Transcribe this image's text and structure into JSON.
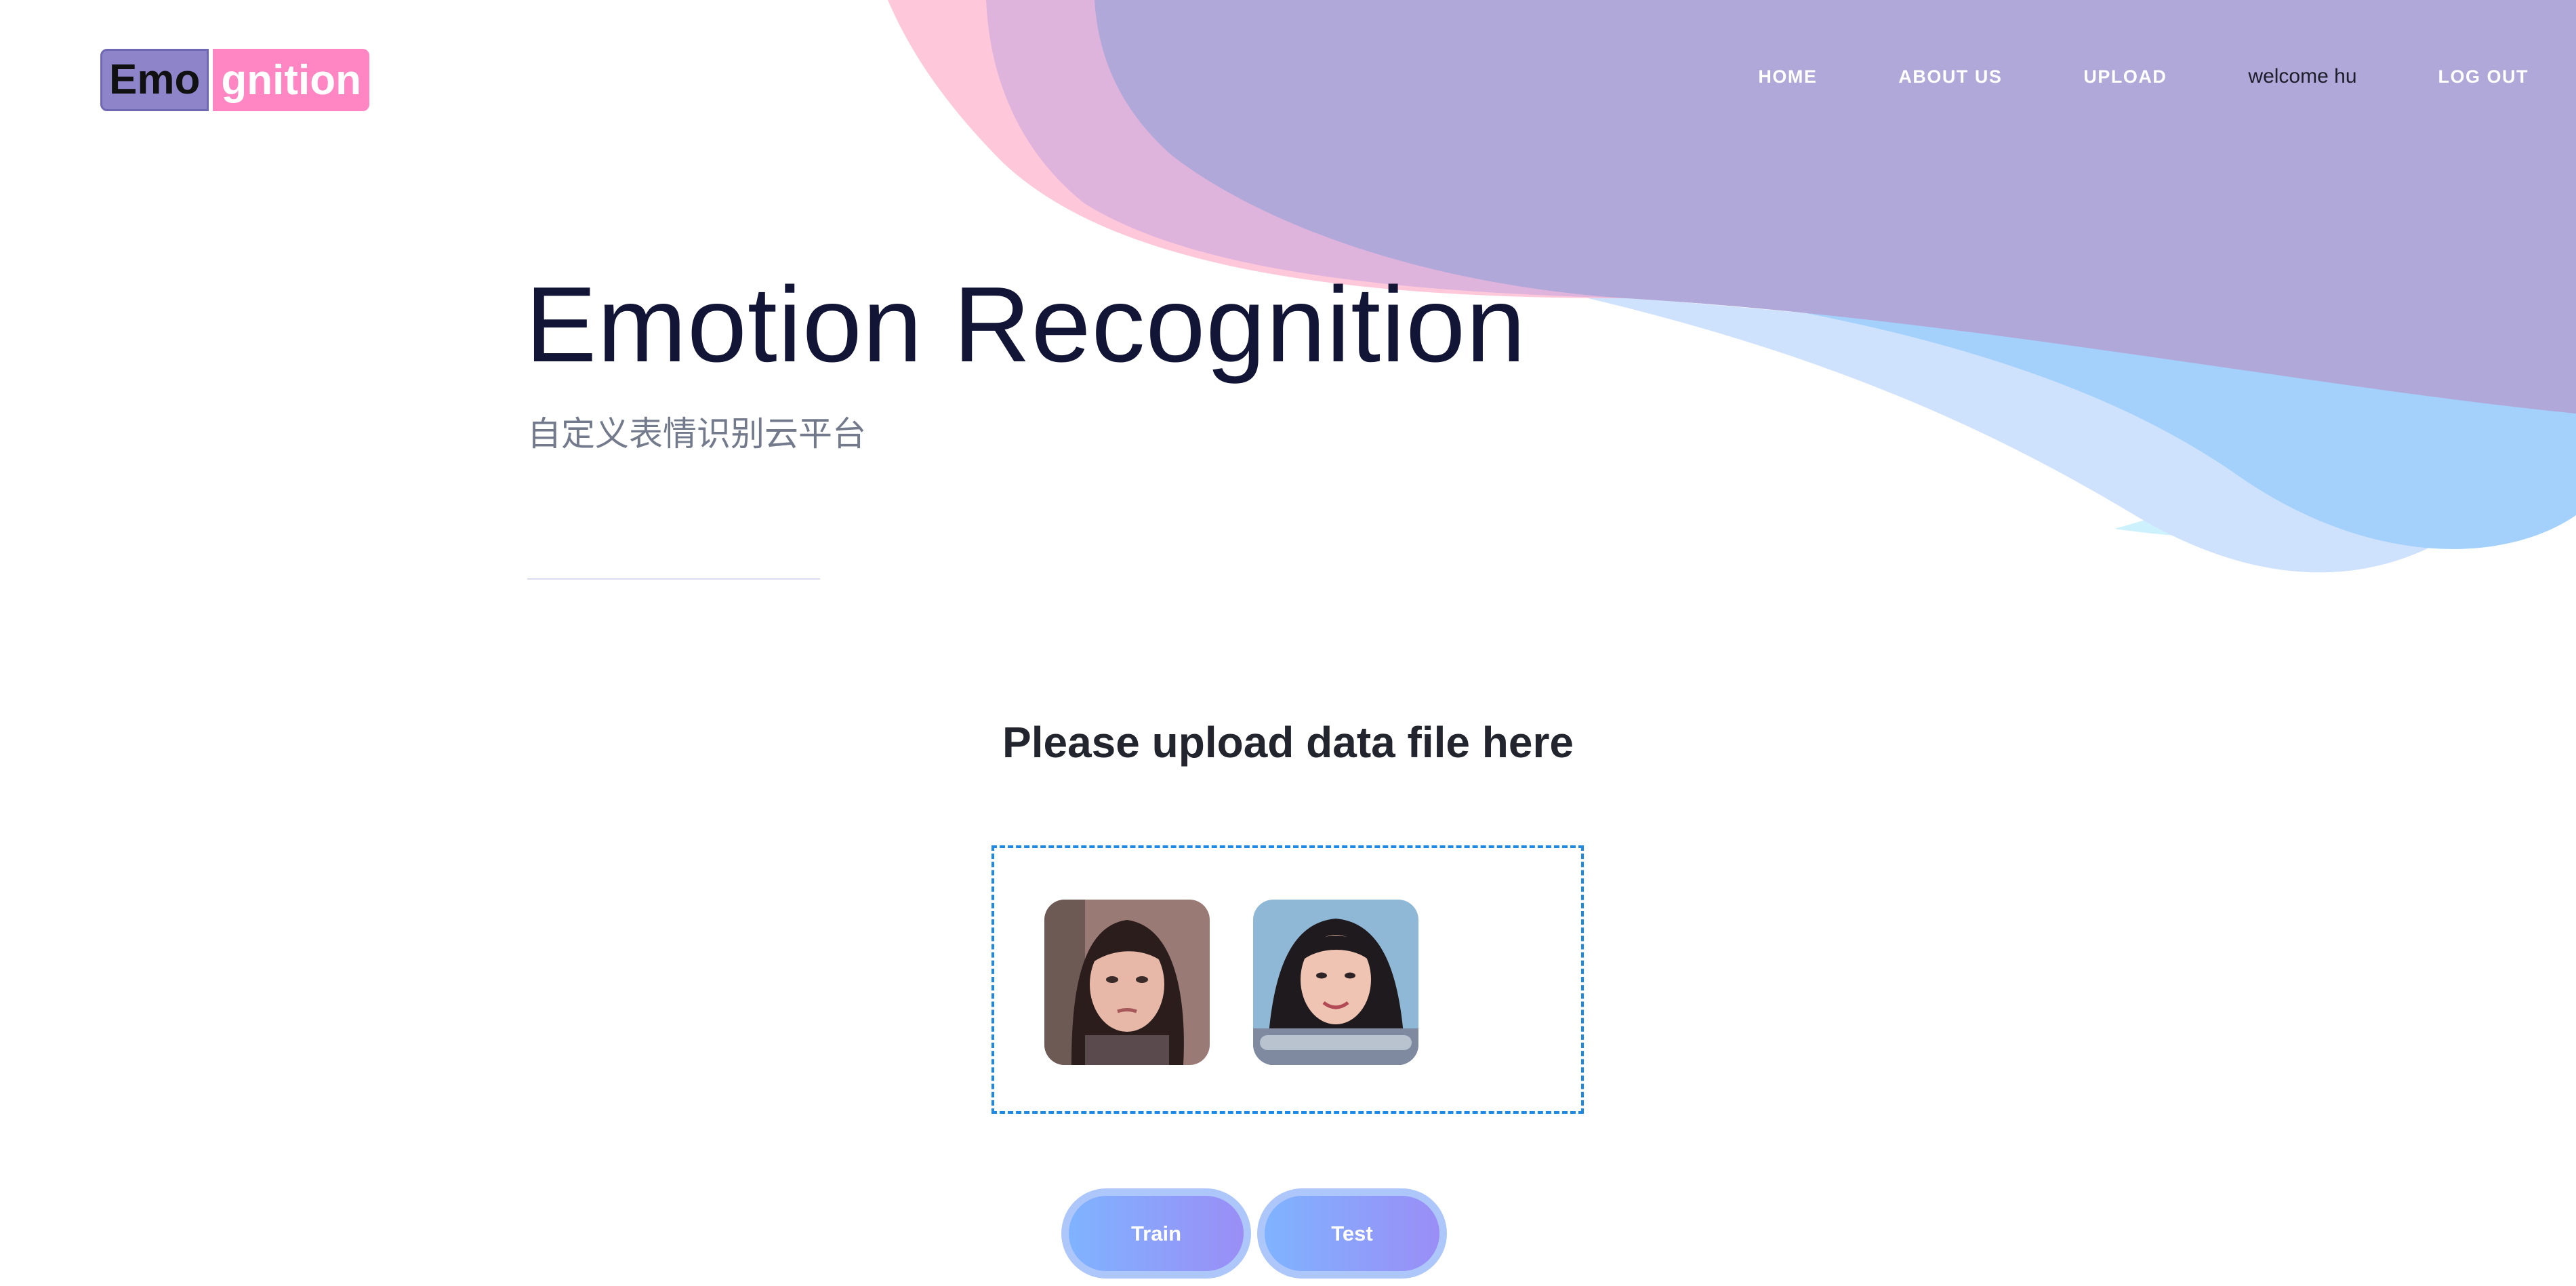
{
  "logo": {
    "part1": "Emo",
    "part2": "gnition"
  },
  "nav": {
    "home": "HOME",
    "about": "ABOUT US",
    "upload": "UPLOAD",
    "welcome": "welcome hu",
    "logout": "LOG OUT"
  },
  "hero": {
    "title": "Emotion Recognition",
    "subtitle": "自定义表情识别云平台"
  },
  "upload": {
    "heading": "Please upload data file here",
    "thumbnails": [
      "face-photo-sad",
      "face-photo-smiling"
    ]
  },
  "buttons": {
    "train": "Train",
    "test": "Test"
  },
  "colors": {
    "logo_left": "#8d84c9",
    "logo_right": "#ff86c3",
    "wave_pink": "#ffc8da",
    "wave_purple": "#b0a8d9",
    "wave_blue": "#a3d1fc",
    "dropzone_border": "#1e88e5"
  }
}
